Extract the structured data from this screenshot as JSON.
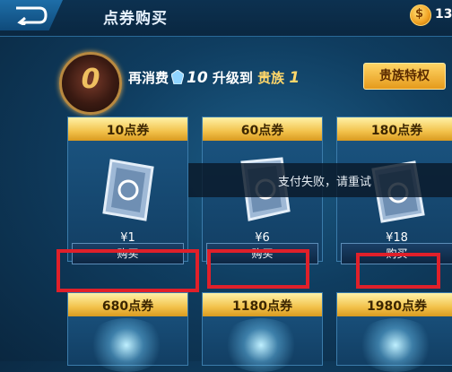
{
  "header": {
    "title": "点券购买",
    "coin_symbol": "$",
    "coin_amount": "13"
  },
  "vip": {
    "level": "0",
    "text_prefix": "再消费",
    "amount": "10",
    "text_middle": "升级到",
    "rank": "贵族",
    "rank_level": "1",
    "button_label": "贵族特权"
  },
  "cards": [
    {
      "name": "10点券",
      "price": "¥1",
      "buy_label": "购买"
    },
    {
      "name": "60点券",
      "price": "¥6",
      "buy_label": "购买"
    },
    {
      "name": "180点券",
      "price": "¥18",
      "buy_label": "购买"
    },
    {
      "name": "680点券"
    },
    {
      "name": "1180点券"
    },
    {
      "name": "1980点券"
    }
  ],
  "toast": {
    "message": "支付失败，请重试"
  },
  "colors": {
    "accent_gold": "#f2c24b",
    "highlight_red": "#e0202a",
    "background": "#0f3d60"
  }
}
